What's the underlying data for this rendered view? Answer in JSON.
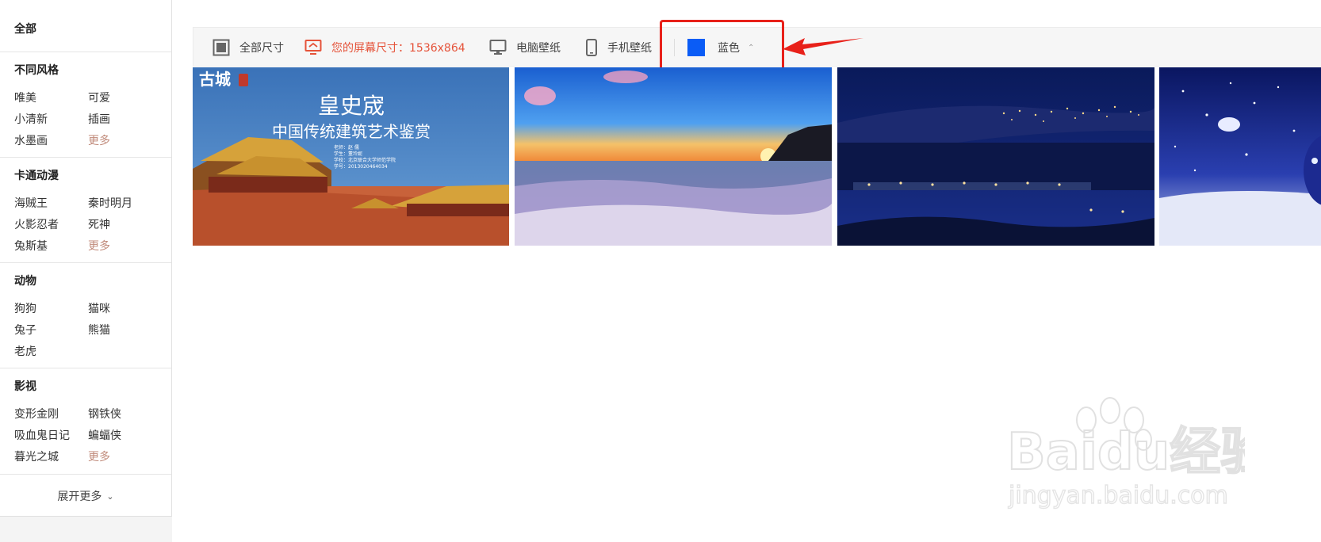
{
  "sidebar": {
    "all_label": "全部",
    "sections": [
      {
        "heading": "不同风格",
        "items": [
          "唯美",
          "可爱",
          "小清新",
          "插画",
          "水墨画",
          "更多"
        ]
      },
      {
        "heading": "卡通动漫",
        "items": [
          "海贼王",
          "秦时明月",
          "火影忍者",
          "死神",
          "兔斯基",
          "更多"
        ]
      },
      {
        "heading": "动物",
        "items": [
          "狗狗",
          "猫咪",
          "兔子",
          "熊猫",
          "老虎"
        ]
      },
      {
        "heading": "影视",
        "items": [
          "变形金刚",
          "钢铁侠",
          "吸血鬼日记",
          "蝙蝠侠",
          "暮光之城",
          "更多"
        ]
      }
    ],
    "expand_label": "展开更多",
    "expand_chevron": "⌄"
  },
  "toolbar": {
    "all_sizes": "全部尺寸",
    "screen_size": "您的屏幕尺寸：1536x864",
    "pc_wallpaper": "电脑壁纸",
    "phone_wallpaper": "手机壁纸",
    "color_label": "蓝色",
    "color_caret": "⌃",
    "swatch_color": "#0a5cf6",
    "active_color": "#e5533a"
  },
  "thumbnails": [
    {
      "title": "皇史宬",
      "subtitle": "中国传统建筑艺术鉴赏",
      "stamp": "古城",
      "lines": [
        "老师：赵 儒",
        "学生：董玲妮",
        "学校：北京联合大学师范学院",
        "学号：2013020464034"
      ]
    },
    {
      "title": ""
    },
    {
      "title": ""
    },
    {
      "title": ""
    }
  ],
  "watermark": {
    "brand": "Baidu经验",
    "url": "jingyan.baidu.com"
  },
  "annotation": {
    "highlight_color": "#e8211a"
  }
}
